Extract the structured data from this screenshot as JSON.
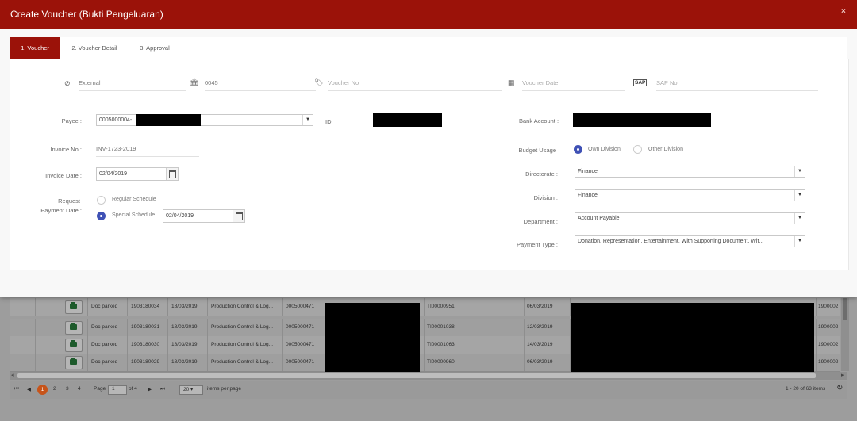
{
  "modal": {
    "title": "Create Voucher (Bukti Pengeluaran)",
    "close": "×",
    "tabs": [
      {
        "label": "1. Voucher"
      },
      {
        "label": "2. Voucher Detail"
      },
      {
        "label": "3. Approval"
      }
    ]
  },
  "form": {
    "top_row": {
      "type_value": "External",
      "bank_code_value": "0045",
      "voucher_no_placeholder": "Voucher No",
      "voucher_date_placeholder": "Voucher Date",
      "sap_icon_text": "SAP",
      "sap_no_placeholder": "SAP No"
    },
    "payee": {
      "label": "Payee :",
      "value": "0005000004-"
    },
    "id": {
      "label": "ID"
    },
    "bank_account": {
      "label": "Bank Account :"
    },
    "invoice_no": {
      "label": "Invoice No :",
      "value": "INV-1723-2019"
    },
    "invoice_date": {
      "label": "Invoice Date :",
      "value": "02/04/2019"
    },
    "request_payment_date": {
      "label_line1": "Request",
      "label_line2": "Payment Date :",
      "regular_label": "Regular Schedule",
      "special_label": "Special Schedule",
      "special_date": "02/04/2019"
    },
    "budget_usage": {
      "label": "Budget Usage",
      "options": [
        "Own Division",
        "Other Division"
      ],
      "selected": "Own Division"
    },
    "directorate": {
      "label": "Directorate :",
      "value": "Finance"
    },
    "division": {
      "label": "Division :",
      "value": "Finance"
    },
    "department": {
      "label": "Department :",
      "value": "Account Payable"
    },
    "payment_type": {
      "label": "Payment Type :",
      "value": "Donation, Representation, Entertainment, With Supporting Document, Wit..."
    }
  },
  "background_grid": {
    "rows": [
      {
        "status": "Doc parked",
        "doc_no": "1903180034",
        "date": "18/03/2019",
        "dept": "Production Control & Log...",
        "vendor": "0005000471",
        "ti": "TI00000951",
        "date2": "06/03/2019",
        "last": "1900002"
      },
      {
        "status": "Doc parked",
        "doc_no": "1903180031",
        "date": "18/03/2019",
        "dept": "Production Control & Log...",
        "vendor": "0005000471",
        "ti": "TI00001038",
        "date2": "12/03/2019",
        "last": "1900002"
      },
      {
        "status": "Doc parked",
        "doc_no": "1903180030",
        "date": "18/03/2019",
        "dept": "Production Control & Log...",
        "vendor": "0005000471",
        "ti": "TI00001063",
        "date2": "14/03/2019",
        "last": "1900002"
      },
      {
        "status": "Doc parked",
        "doc_no": "1903180029",
        "date": "18/03/2019",
        "dept": "Production Control & Log...",
        "vendor": "0005000471",
        "ti": "TI00000960",
        "date2": "06/03/2019",
        "last": "1900002"
      }
    ],
    "pager": {
      "first": "⏮",
      "prev": "◀",
      "pages": [
        "1",
        "2",
        "3",
        "4"
      ],
      "page_label": "Page",
      "page_value": "1",
      "of_label": "of 4",
      "next": "▶",
      "last": "⏭",
      "page_size": "20",
      "items_per_page": "items per page",
      "summary": "1 - 20 of 63 items",
      "refresh": "↻"
    }
  }
}
